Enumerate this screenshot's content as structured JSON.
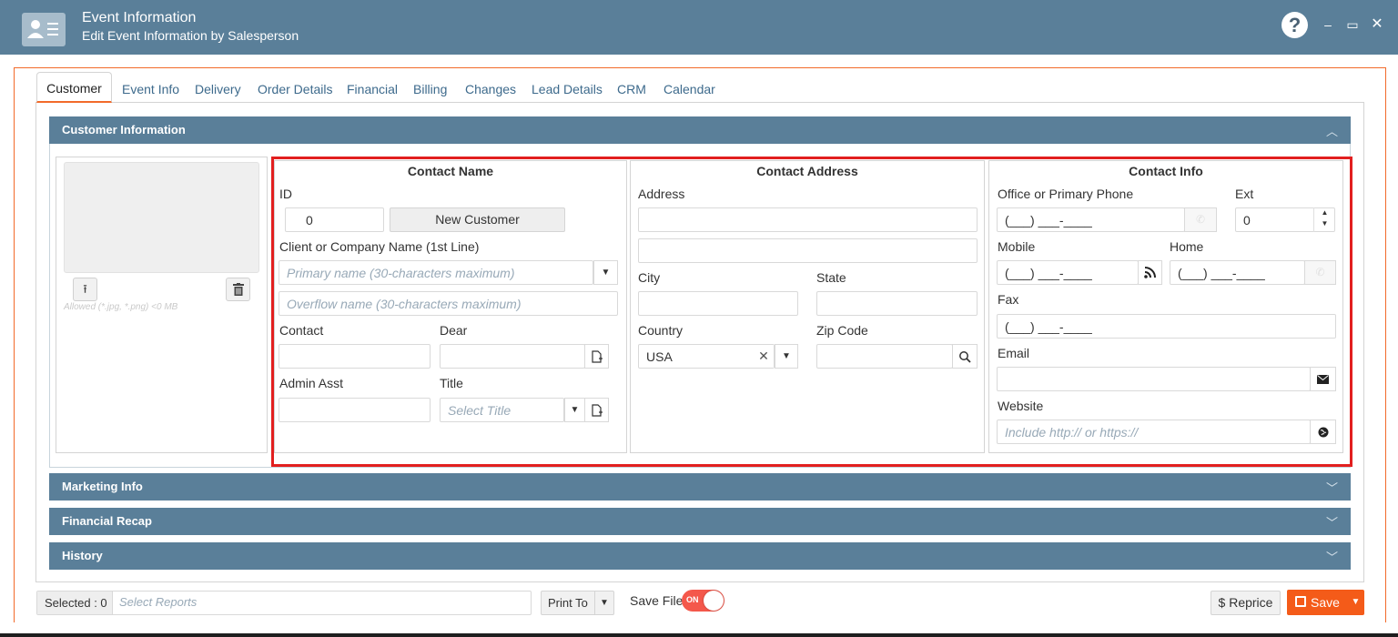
{
  "window": {
    "title": "Event Information",
    "subtitle": "Edit Event Information by Salesperson",
    "help_icon": "?",
    "minimize": "–",
    "maximize": "▭",
    "close": "✕"
  },
  "tabs": [
    {
      "label": "Customer",
      "active": true
    },
    {
      "label": "Event Info"
    },
    {
      "label": "Delivery"
    },
    {
      "label": "Order Details"
    },
    {
      "label": "Financial"
    },
    {
      "label": "Billing"
    },
    {
      "label": "Changes"
    },
    {
      "label": "Lead Details"
    },
    {
      "label": "CRM"
    },
    {
      "label": "Calendar"
    }
  ],
  "sections": {
    "customer_information": "Customer Information",
    "marketing_info": "Marketing Info",
    "financial_recap": "Financial Recap",
    "history": "History",
    "chevron_up": "︿",
    "chevron_down": "﹀"
  },
  "photo": {
    "allowed_note": "Allowed (*.jpg, *.png) <0 MB",
    "upload_icon": "⭱",
    "delete_icon": "🗑"
  },
  "contact_name": {
    "title": "Contact Name",
    "id_label": "ID",
    "id_value": "0",
    "new_customer_button": "New Customer",
    "company_label": "Client or Company Name (1st Line)",
    "primary_placeholder": "Primary name (30-characters maximum)",
    "overflow_placeholder": "Overflow name (30-characters maximum)",
    "contact_label": "Contact",
    "dear_label": "Dear",
    "admin_label": "Admin Asst",
    "title_label": "Title",
    "title_placeholder": "Select Title"
  },
  "contact_address": {
    "title": "Contact Address",
    "address_label": "Address",
    "city_label": "City",
    "state_label": "State",
    "country_label": "Country",
    "country_value": "USA",
    "zip_label": "Zip Code"
  },
  "contact_info": {
    "title": "Contact Info",
    "office_label": "Office or Primary Phone",
    "office_value": "(___) ___-____",
    "ext_label": "Ext",
    "ext_value": "0",
    "mobile_label": "Mobile",
    "mobile_value": "(___) ___-____",
    "home_label": "Home",
    "home_value": "(___) ___-____",
    "fax_label": "Fax",
    "fax_value": "(___) ___-____",
    "email_label": "Email",
    "website_label": "Website",
    "website_placeholder": "Include http:// or https://"
  },
  "footer": {
    "selected_label": "Selected : 0",
    "select_reports_placeholder": "Select Reports",
    "print_to": "Print To",
    "save_file_label": "Save File",
    "toggle_text": "ON",
    "toggle_on": true,
    "reprice": "$  Reprice",
    "save": "Save"
  },
  "colors": {
    "header": "#5a7f99",
    "accent_orange": "#f45b19",
    "highlight_red": "#e21f1f",
    "toggle_on": "#f4584b"
  }
}
